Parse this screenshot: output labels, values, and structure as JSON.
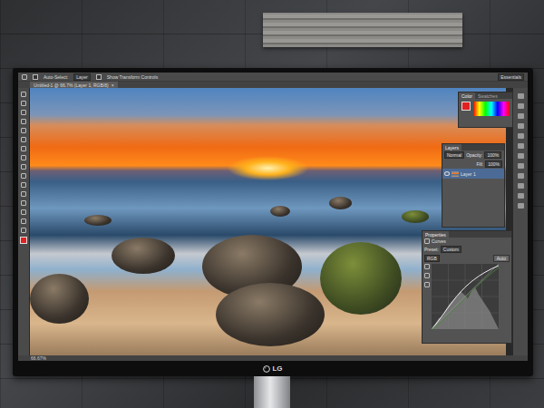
{
  "monitor": {
    "logo": "LG"
  },
  "app": {
    "options_bar": {
      "auto_select": "Auto-Select:",
      "target": "Layer",
      "transform": "Show Transform Controls",
      "workspace": "Essentials"
    },
    "document_tab": {
      "label": "Untitled-1 @ 66.7% (Layer 1, RGB/8)",
      "close": "×",
      "selected": true
    },
    "color_panel": {
      "tabs": [
        {
          "label": "Color",
          "selected": true
        },
        {
          "label": "Swatches",
          "selected": false
        }
      ]
    },
    "layers_panel": {
      "title": "Layers",
      "blend": "Normal",
      "opacity_label": "Opacity:",
      "opacity": "100%",
      "fill_label": "Fill:",
      "fill": "100%",
      "layers": [
        {
          "name": "Layer 1",
          "selected": true,
          "visible": true
        }
      ]
    },
    "properties_panel": {
      "title": "Properties",
      "adjustment": "Curves",
      "preset_label": "Preset:",
      "preset": "Custom",
      "channel": "RGB",
      "auto": "Auto"
    },
    "status_bar": {
      "zoom": "66.67%"
    }
  }
}
